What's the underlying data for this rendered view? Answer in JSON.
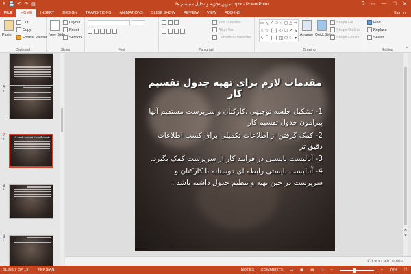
{
  "window": {
    "title": "تمرين تجزيه و تحليل سيستم ها.pptx - PowerPoint",
    "controls": [
      "?",
      "▭",
      "—",
      "☐",
      "✕"
    ],
    "qat": [
      "P",
      "💾",
      "↶",
      "↷",
      "▤"
    ]
  },
  "tabs": {
    "file": "FILE",
    "items": [
      "HOME",
      "INSERT",
      "DESIGN",
      "TRANSITIONS",
      "ANIMATIONS",
      "SLIDE SHOW",
      "REVIEW",
      "VIEW",
      "ADD-INS"
    ],
    "active": "HOME",
    "account": "Sign in"
  },
  "ribbon": {
    "clipboard": {
      "label": "Clipboard",
      "paste": "Paste",
      "cut": "Cut",
      "copy": "Copy",
      "format_painter": "Format Painter"
    },
    "slides": {
      "label": "Slides",
      "new_slide": "New Slide",
      "layout": "Layout",
      "reset": "Reset",
      "section": "Section"
    },
    "font": {
      "label": "Font"
    },
    "paragraph": {
      "label": "Paragraph",
      "text_direction": "Text Direction",
      "align_text": "Align Text",
      "convert_smartart": "Convert to SmartArt"
    },
    "drawing": {
      "label": "Drawing",
      "arrange": "Arrange",
      "quick_styles": "Quick Styles",
      "shape_fill": "Shape Fill",
      "shape_outline": "Shape Outline",
      "shape_effects": "Shape Effects"
    },
    "editing": {
      "label": "Editing",
      "find": "Find",
      "replace": "Replace",
      "select": "Select"
    }
  },
  "thumbnails": [
    {
      "num": "",
      "title": "",
      "lines": 5,
      "selected": false
    },
    {
      "num": "6",
      "title": "",
      "lines": 6,
      "selected": false
    },
    {
      "num": "7",
      "title": "مقدمات لازم براى تهيه جدول تقسيم كار",
      "lines": 6,
      "selected": true
    },
    {
      "num": "8",
      "title": "",
      "lines": 6,
      "selected": false
    },
    {
      "num": "9",
      "title": "",
      "lines": 4,
      "selected": false
    }
  ],
  "slide": {
    "title": "مقدمات لازم براى تهيه جدول تقسيم كار",
    "bullets": [
      "1- تشكيل جلسه توجيهى ،كاركنان و سرپرست مستقيم آنها پيرامون جدول تقسيم كار",
      "2- كمک گرفتن از اطلاعات تكميلى براى كسب اطلاعات دقيق تر",
      "3- آناليست بايستى در فرايند كار از سرپرست كمک بگيرد.",
      "4- آناليست بايستى رابطه اى دوستانه با كاركنان و سرپرست در حين تهيه و تنظيم جدول داشته باشد ."
    ]
  },
  "notes_placeholder": "Click to add notes",
  "status": {
    "slide_info": "SLIDE 7 OF 19",
    "language": "PERSIAN",
    "notes": "NOTES",
    "comments": "COMMENTS",
    "zoom": "70%"
  }
}
